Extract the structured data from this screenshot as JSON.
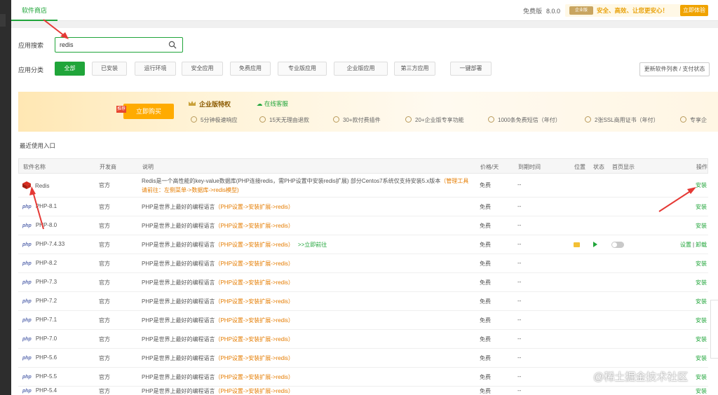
{
  "topbar": {
    "tab_label": "软件商店",
    "version_label": "免费版",
    "version_number": "8.0.0",
    "ent_logo": "企业版",
    "slogan": "安全、高效、让您更安心！",
    "try_label": "立即体验"
  },
  "search": {
    "label": "应用搜索",
    "value": "redis"
  },
  "categories": {
    "label": "应用分类",
    "items": [
      "全部",
      "已安装",
      "运行环境",
      "安全应用",
      "免费应用",
      "专业版应用",
      "企业版应用",
      "第三方应用",
      "一键部署"
    ],
    "active": "全部"
  },
  "update_label": "更新软件列表 / 支付状态",
  "promo": {
    "tag": "推荐",
    "buy_label": "立即购买",
    "title": "企业版特权",
    "service": "在线客服",
    "features": [
      "5分钟极速响应",
      "15天无理由退款",
      "30+款付费插件",
      "20+企业版专享功能",
      "1000条免费短信（年付）",
      "2张SSL商用证书（年付）",
      "专享企"
    ]
  },
  "recent_label": "最近使用入口",
  "table": {
    "headers": [
      "软件名称",
      "开发商",
      "说明",
      "价格/天",
      "到期时间",
      "位置",
      "状态",
      "首页显示",
      "操作"
    ],
    "rows": [
      {
        "name": "Redis",
        "dev": "官方",
        "desc": "Redis是一个高性能的key-value数据库(PHP连接redis，需PHP设置中安装redis扩展) 部分Centos7系统仅支持安装5.x版本",
        "desc_tip": "（管理工具",
        "desc_tip2": "请前往：左侧菜单->数据库->redis模型)",
        "price": "免费",
        "expire": "--",
        "op": "安装"
      },
      {
        "name": "PHP-8.1",
        "dev": "官方",
        "desc": "PHP是世界上最好的编程语言",
        "desc_tip": "（PHP设置->安装扩展->redis）",
        "price": "免费",
        "expire": "--",
        "op": "安装"
      },
      {
        "name": "PHP-8.0",
        "dev": "官方",
        "desc": "PHP是世界上最好的编程语言",
        "desc_tip": "（PHP设置->安装扩展->redis）",
        "price": "免费",
        "expire": "--",
        "op": "安装"
      },
      {
        "name": "PHP-7.4.33",
        "dev": "官方",
        "desc": "PHP是世界上最好的编程语言",
        "desc_tip": "（PHP设置->安装扩展->redis）",
        "desc_link": ">>立即前往",
        "price": "免费",
        "expire": "--",
        "op_settings": "设置",
        "op_sep": "|",
        "op_uninstall": "卸载"
      },
      {
        "name": "PHP-8.2",
        "dev": "官方",
        "desc": "PHP是世界上最好的编程语言",
        "desc_tip": "（PHP设置->安装扩展->redis）",
        "price": "免费",
        "expire": "--",
        "op": "安装"
      },
      {
        "name": "PHP-7.3",
        "dev": "官方",
        "desc": "PHP是世界上最好的编程语言",
        "desc_tip": "（PHP设置->安装扩展->redis）",
        "price": "免费",
        "expire": "--",
        "op": "安装"
      },
      {
        "name": "PHP-7.2",
        "dev": "官方",
        "desc": "PHP是世界上最好的编程语言",
        "desc_tip": "（PHP设置->安装扩展->redis）",
        "price": "免费",
        "expire": "--",
        "op": "安装"
      },
      {
        "name": "PHP-7.1",
        "dev": "官方",
        "desc": "PHP是世界上最好的编程语言",
        "desc_tip": "（PHP设置->安装扩展->redis）",
        "price": "免费",
        "expire": "--",
        "op": "安装"
      },
      {
        "name": "PHP-7.0",
        "dev": "官方",
        "desc": "PHP是世界上最好的编程语言",
        "desc_tip": "（PHP设置->安装扩展->redis）",
        "price": "免费",
        "expire": "--",
        "op": "安装"
      },
      {
        "name": "PHP-5.6",
        "dev": "官方",
        "desc": "PHP是世界上最好的编程语言",
        "desc_tip": "（PHP设置->安装扩展->redis）",
        "price": "免费",
        "expire": "--",
        "op": "安装"
      },
      {
        "name": "PHP-5.5",
        "dev": "官方",
        "desc": "PHP是世界上最好的编程语言",
        "desc_tip": "（PHP设置->安装扩展->redis）",
        "price": "免费",
        "expire": "--",
        "op": "安装"
      },
      {
        "name": "PHP-5.4",
        "dev": "官方",
        "desc": "PHP是世界上最好的编程语言",
        "desc_tip": "（PHP设置->安装扩展->redis）",
        "price": "免费",
        "expire": "--",
        "op": "安装"
      }
    ]
  },
  "php_logo": "php",
  "watermark": "@稀土掘金技术社区",
  "colors": {
    "accent": "#20a53a",
    "orange": "#e57c00",
    "gold": "#f0a300",
    "annotation": "#e53935"
  }
}
